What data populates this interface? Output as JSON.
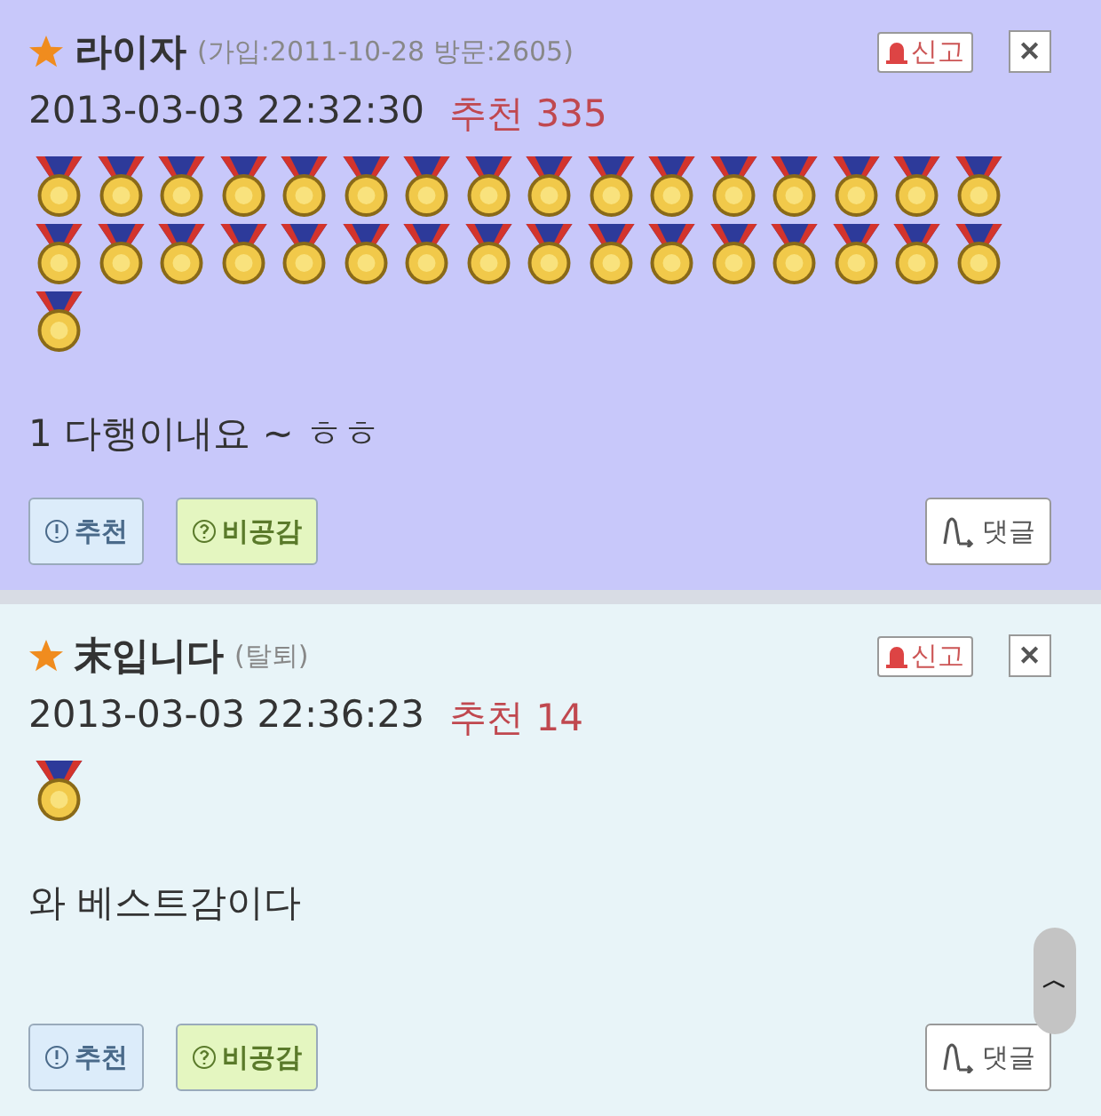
{
  "comments": [
    {
      "author": "라이자",
      "meta": "(가입:2011-10-28 방문:2605)",
      "report": "신고",
      "close": "✕",
      "timestamp": "2013-03-03 22:32:30",
      "recommend_label": "추천",
      "recommend_count": "335",
      "medals": [
        {
          "kind": "gold"
        },
        {
          "kind": "gold"
        },
        {
          "kind": "gold"
        },
        {
          "kind": "gold"
        },
        {
          "kind": "gold"
        },
        {
          "kind": "gold"
        },
        {
          "kind": "gold"
        },
        {
          "kind": "gold"
        },
        {
          "kind": "gold"
        },
        {
          "kind": "gold"
        },
        {
          "kind": "gold"
        },
        {
          "kind": "gold"
        },
        {
          "kind": "gold"
        },
        {
          "kind": "gold"
        },
        {
          "kind": "gold"
        },
        {
          "kind": "gold"
        },
        {
          "kind": "gold"
        },
        {
          "kind": "gold"
        },
        {
          "kind": "gold"
        },
        {
          "kind": "gold"
        },
        {
          "kind": "gold"
        },
        {
          "kind": "gold"
        },
        {
          "kind": "gold"
        },
        {
          "kind": "gold"
        },
        {
          "kind": "gold"
        },
        {
          "kind": "gold"
        },
        {
          "kind": "gold"
        },
        {
          "kind": "gold"
        },
        {
          "kind": "gold"
        },
        {
          "kind": "gold"
        },
        {
          "kind": "gold"
        },
        {
          "kind": "gold"
        },
        {
          "kind": "gold"
        }
      ],
      "body": "1 다행이내요 ~ ㅎㅎ",
      "upvote": "추천",
      "downvote": "비공감",
      "reply": "댓글",
      "color": "#c8c8fa"
    },
    {
      "author": "末입니다",
      "meta": "(탈퇴)",
      "report": "신고",
      "close": "✕",
      "timestamp": "2013-03-03 22:36:23",
      "recommend_label": "추천",
      "recommend_count": "14",
      "medals": [
        {
          "kind": "gold"
        }
      ],
      "body": "와 베스트감이다",
      "upvote": "추천",
      "downvote": "비공감",
      "reply": "댓글",
      "color": "#e8f4f8"
    }
  ],
  "scroll_top": {
    "label": "︿"
  }
}
